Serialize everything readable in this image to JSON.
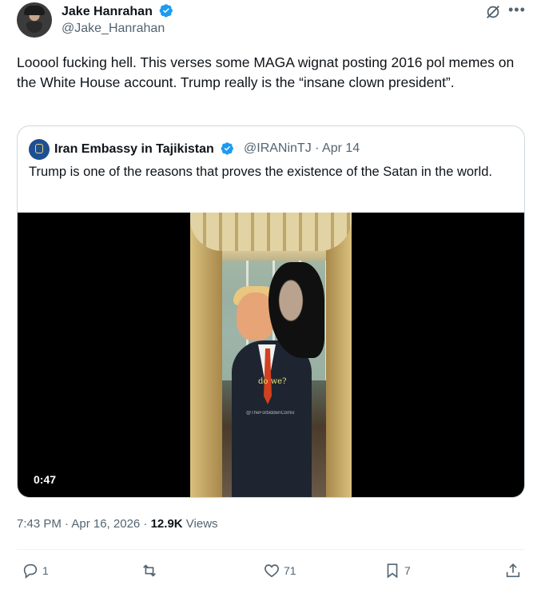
{
  "author": {
    "name": "Jake Hanrahan",
    "handle": "@Jake_Hanrahan",
    "verified_color": "#1d9bf0"
  },
  "header_icons": [
    "grok-icon",
    "more-icon"
  ],
  "tweet": {
    "text": "Looool fucking hell. This verses some MAGA wignat posting 2016 pol memes on the White House account. Trump really is the “insane clown president”."
  },
  "quoted": {
    "name": "Iran Embassy in Tajikistan",
    "meta": "@IRANinTJ · Apr 14",
    "text": "Trump is one of the reasons that proves the existence of the Satan in the world.",
    "video": {
      "overlay_text": "do we?",
      "watermark": "@TheForbiddenComix",
      "duration": "0:47"
    }
  },
  "timestamp": {
    "datetime": "7:43 PM · Apr 16, 2026 · ",
    "views_count": "12.9K",
    "views_label": " Views"
  },
  "actions": {
    "reply": "1",
    "retweet": "",
    "like": "71",
    "bookmark": "7"
  },
  "colors": {
    "text_primary": "#0f1419",
    "text_secondary": "#536471",
    "border": "#cfd9de",
    "accent": "#1d9bf0"
  }
}
